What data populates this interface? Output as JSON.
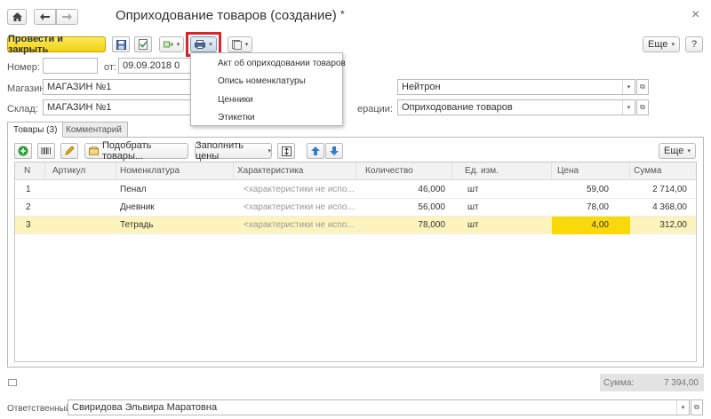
{
  "window": {
    "title": "Оприходование товаров (создание)",
    "modified_mark": "*"
  },
  "nav": {
    "home_icon": "home-icon",
    "back_icon": "arrow-left-icon",
    "forward_icon": "arrow-right-icon",
    "close": "×"
  },
  "toolbar": {
    "post_close_label": "Провести и закрыть",
    "more_label": "Еще",
    "more_caret": "▾",
    "help": "?"
  },
  "print_menu": {
    "items": [
      "Акт об оприходовании товаров",
      "Опись номенклатуры",
      "Ценники",
      "Этикетки"
    ]
  },
  "header": {
    "number_label": "Номер:",
    "number_value": "",
    "date_label": "от:",
    "date_value": "09.09.2018 0",
    "store_label": "Магазин:",
    "store_value": "МАГАЗИН №1",
    "warehouse_label": "Склад:",
    "warehouse_value": "МАГАЗИН №1",
    "org_value": "Нейтрон",
    "operation_label": "ерации:",
    "operation_value": "Оприходование товаров"
  },
  "tabs": [
    {
      "label": "Товары (3)"
    },
    {
      "label": "Комментарий"
    }
  ],
  "table_toolbar": {
    "pick_label": "Подобрать товары...",
    "fill_prices_label": "Заполнить цены",
    "more_label": "Еще"
  },
  "table": {
    "columns": [
      "N",
      "Артикул",
      "Номенклатура",
      "Характеристика",
      "Количество",
      "Ед. изм.",
      "Цена",
      "Сумма"
    ],
    "rows": [
      {
        "n": "1",
        "article": "",
        "name": "Пенал",
        "char": "<характеристики не испо...",
        "qty": "46,000",
        "unit": "шт",
        "price": "59,00",
        "sum": "2 714,00"
      },
      {
        "n": "2",
        "article": "",
        "name": "Дневник",
        "char": "<характеристики не испо...",
        "qty": "56,000",
        "unit": "шт",
        "price": "78,00",
        "sum": "4 368,00"
      },
      {
        "n": "3",
        "article": "",
        "name": "Тетрадь",
        "char": "<характеристики не испо...",
        "qty": "78,000",
        "unit": "шт",
        "price": "4,00",
        "sum": "312,00"
      }
    ]
  },
  "footer": {
    "total_label": "Сумма:",
    "total_value": "7 394,00",
    "responsible_label": "Ответственный:",
    "responsible_value": "Свиридова Эльвира Маратовна"
  },
  "colors": {
    "accent_yellow": "#f2d211",
    "selected_row": "#fdf4bd",
    "highlight_cell": "#f9d90c",
    "print_box": "#d9232d"
  }
}
